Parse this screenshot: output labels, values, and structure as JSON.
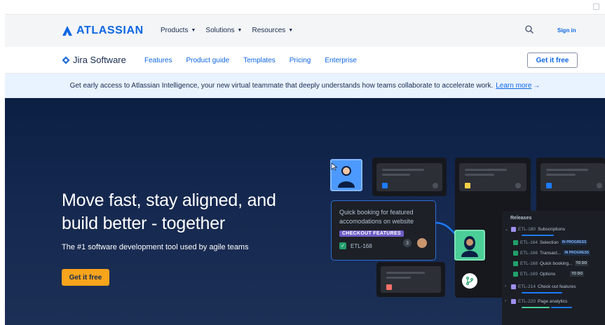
{
  "global_nav": {
    "logo_text": "ATLASSIAN",
    "links": [
      "Products",
      "Solutions",
      "Resources"
    ],
    "signin": "Sign in"
  },
  "product_nav": {
    "product": "Jira Software",
    "links": [
      "Features",
      "Product guide",
      "Templates",
      "Pricing",
      "Enterprise"
    ],
    "cta": "Get it free"
  },
  "banner": {
    "text": "Get early access to Atlassian Intelligence, your new virtual teammate that deeply understands how teams collaborate to accelerate work.",
    "link": "Learn more",
    "arrow": "→"
  },
  "hero": {
    "title": "Move fast, stay aligned, and build better - together",
    "subtitle": "The #1 software development tool used by agile teams",
    "cta": "Get it free"
  },
  "illustration": {
    "quick_card": {
      "title": "Quick booking for featured accomodations on website",
      "tag": "CHECKOUT FEATURES",
      "key": "ETL-168",
      "count": "3"
    },
    "releases": {
      "title": "Releases",
      "rows": [
        {
          "key": "ETL-180",
          "label": "Subscriptions",
          "badge": ""
        },
        {
          "key": "ETL-164",
          "label": "Selection",
          "badge": "IN PROGRESS"
        },
        {
          "key": "ETL-166",
          "label": "Transact...",
          "badge": "IN PROGRESS"
        },
        {
          "key": "ETL-168",
          "label": "Quick booking...",
          "badge": "TO DO"
        },
        {
          "key": "ETL-169",
          "label": "Options",
          "badge": "TO DO"
        },
        {
          "key": "ETL-214",
          "label": "Check out features",
          "badge": ""
        },
        {
          "key": "ETL-220",
          "label": "Page analytics",
          "badge": ""
        }
      ]
    }
  },
  "colors": {
    "brand_blue": "#0c66e4",
    "hero_bg": "#0b1f44",
    "cta_yellow": "#f8a41d",
    "tag_purple": "#6e5dc6",
    "banner_bg": "#e9f2ff"
  }
}
